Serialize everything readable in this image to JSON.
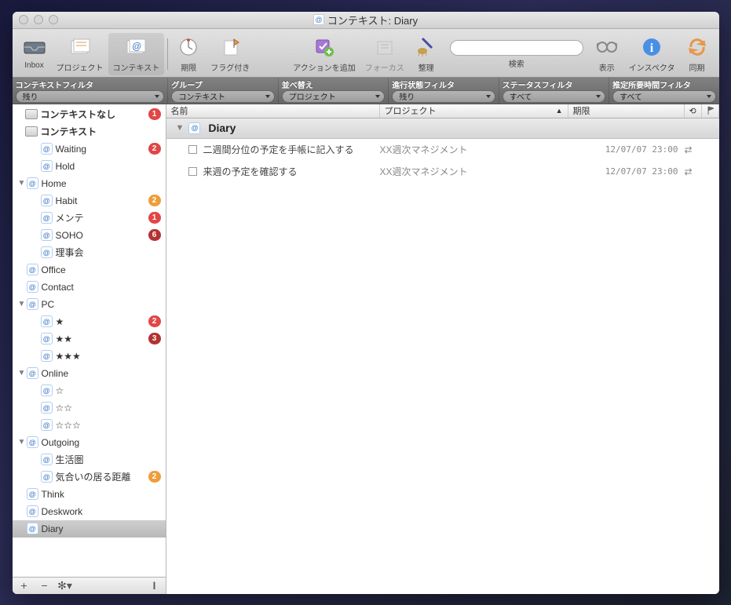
{
  "window": {
    "title": "コンテキスト: Diary"
  },
  "toolbar": {
    "inbox": "Inbox",
    "project": "プロジェクト",
    "context": "コンテキスト",
    "due": "期限",
    "flagged": "フラグ付き",
    "addAction": "アクションを追加",
    "focus": "フォーカス",
    "cleanup": "整理",
    "searchLabel": "検索",
    "view": "表示",
    "inspector": "インスペクタ",
    "sync": "同期"
  },
  "filters": {
    "context": {
      "label": "コンテキストフィルタ",
      "value": "残り"
    },
    "group": {
      "label": "グループ",
      "value": "コンテキスト"
    },
    "sort": {
      "label": "並べ替え",
      "value": "プロジェクト"
    },
    "status": {
      "label": "進行状態フィルタ",
      "value": "残り"
    },
    "taskStatus": {
      "label": "ステータスフィルタ",
      "value": "すべて"
    },
    "estTime": {
      "label": "推定所要時間フィルタ",
      "value": "すべて"
    }
  },
  "sidebar": {
    "noContext": {
      "label": "コンテキストなし",
      "badge": "1"
    },
    "contextsHeader": "コンテキスト",
    "items": [
      {
        "label": "Waiting",
        "badge": "2",
        "badgeColor": "red",
        "indent": 1
      },
      {
        "label": "Hold",
        "indent": 1
      },
      {
        "label": "Home",
        "indent": 0,
        "expandable": true
      },
      {
        "label": "Habit",
        "badge": "2",
        "badgeColor": "orange",
        "indent": 1
      },
      {
        "label": "メンテ",
        "badge": "1",
        "badgeColor": "red",
        "indent": 1
      },
      {
        "label": "SOHO",
        "badge": "6",
        "badgeColor": "darkred",
        "indent": 1
      },
      {
        "label": "理事会",
        "indent": 1
      },
      {
        "label": "Office",
        "indent": 0
      },
      {
        "label": "Contact",
        "indent": 0
      },
      {
        "label": "PC",
        "indent": 0,
        "expandable": true
      },
      {
        "label": "★",
        "badge": "2",
        "badgeColor": "red",
        "indent": 1
      },
      {
        "label": "★★",
        "badge": "3",
        "badgeColor": "darkred",
        "indent": 1
      },
      {
        "label": "★★★",
        "indent": 1
      },
      {
        "label": "Online",
        "indent": 0,
        "expandable": true
      },
      {
        "label": "☆",
        "indent": 1
      },
      {
        "label": "☆☆",
        "indent": 1
      },
      {
        "label": "☆☆☆",
        "indent": 1
      },
      {
        "label": "Outgoing",
        "indent": 0,
        "expandable": true
      },
      {
        "label": "生活圏",
        "indent": 1
      },
      {
        "label": "気合いの居る距離",
        "badge": "2",
        "badgeColor": "orange",
        "indent": 1
      },
      {
        "label": "Think",
        "indent": 0
      },
      {
        "label": "Deskwork",
        "indent": 0
      },
      {
        "label": "Diary",
        "indent": 0,
        "selected": true
      }
    ]
  },
  "columns": {
    "name": "名前",
    "project": "プロジェクト",
    "due": "期限"
  },
  "group": {
    "name": "Diary"
  },
  "tasks": [
    {
      "name": "二週間分位の予定を手帳に記入する",
      "project": "XX週次マネジメント",
      "due": "12/07/07 23:00",
      "repeat": true
    },
    {
      "name": "来週の予定を確認する",
      "project": "XX週次マネジメント",
      "due": "12/07/07 23:00",
      "repeat": true
    }
  ]
}
